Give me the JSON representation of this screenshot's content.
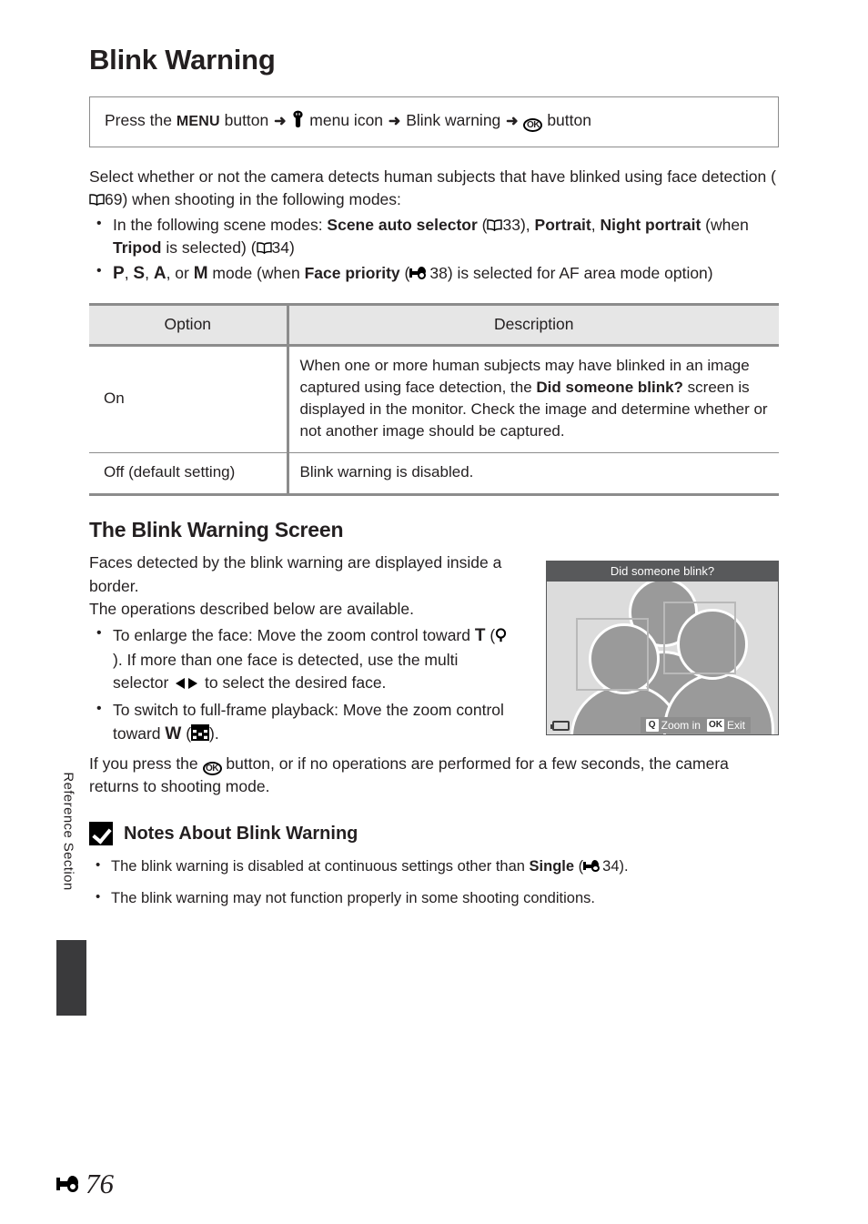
{
  "page": {
    "title": "Blink Warning",
    "side_label": "Reference Section",
    "page_number": "76"
  },
  "nav_box": {
    "lead": "Press the",
    "menu_button": "MENU",
    "button_word_1": "button",
    "menu_icon_label": "menu icon",
    "item": "Blink warning",
    "button_word_2": "button",
    "arrow": "➜",
    "icons": {
      "setup_menu": "wrench-icon",
      "ok": "ok-button-icon"
    }
  },
  "intro": {
    "line1": "Select whether or not the camera detects human subjects that have blinked",
    "line2_a": "using face detection (",
    "line2_ref": "69",
    "line2_b": ") when shooting in the following modes:",
    "bullets": [
      {
        "prefix": "In the following scene modes: ",
        "bold1": "Scene auto selector",
        "ref1": "33",
        "mid1": ", ",
        "bold2": "Portrait",
        "mid2": ", ",
        "bold3": "Night portrait",
        "mid3": " (when ",
        "bold4": "Tripod",
        "mid4": " is selected) (",
        "ref2": "34",
        "suffix": ")"
      },
      {
        "modes": [
          "P",
          "S",
          "A",
          "M"
        ],
        "mid1": ", or ",
        "mid2": " mode (when ",
        "bold1": "Face priority",
        "mid3": " (",
        "ref_e": "38",
        "suffix": ") is selected for AF area mode option)"
      }
    ]
  },
  "table": {
    "headers": [
      "Option",
      "Description"
    ],
    "rows": [
      {
        "option": "On",
        "description_a": "When one or more human subjects may have blinked in an image captured using face detection, the ",
        "description_b": "Did someone blink?",
        "description_c": " screen is displayed in the monitor. Check the image and determine whether or not another image should be captured."
      },
      {
        "option": "Off (default setting)",
        "description_a": "Blink warning is disabled.",
        "description_b": "",
        "description_c": ""
      }
    ]
  },
  "screen_section": {
    "title": "The Blink Warning Screen",
    "para1": "Faces detected by the blink warning are displayed inside a border.",
    "para2": "The operations described below are available.",
    "bullets": [
      {
        "a": "To enlarge the face: Move the zoom control toward ",
        "key": "T",
        "b": " (",
        "c": "). If more than one face is detected, use the multi selector ",
        "d": " to select the desired face."
      },
      {
        "a": "To switch to full-frame playback: Move the zoom control toward ",
        "key": "W",
        "b": " (",
        "c": ")."
      }
    ],
    "closing_a": "If you press the ",
    "closing_b": " button, or if no operations are performed for a few seconds, the camera returns to shooting mode."
  },
  "camera_screen": {
    "title": "Did someone blink?",
    "hints": [
      {
        "key": "Q",
        "label": "Zoom in",
        "icon": "magnifier-icon"
      },
      {
        "key": "OK",
        "label": "Exit",
        "icon": "ok-button-icon"
      }
    ],
    "battery_icon": "battery-icon"
  },
  "notes": {
    "title": "Notes About Blink Warning",
    "icon": "check-badge-icon",
    "items": [
      {
        "a": "The blink warning is disabled at continuous settings other than ",
        "bold": "Single",
        "b": " (",
        "ref_e": "34",
        "c": ")."
      },
      {
        "a": "The blink warning may not function properly in some shooting conditions.",
        "bold": "",
        "b": "",
        "ref_e": "",
        "c": ""
      }
    ]
  },
  "colors": {
    "text": "#231f20",
    "rule": "#8c8c8c",
    "table_header_bg": "#e6e6e6",
    "screen_title_bar": "#58595b",
    "screen_bg": "#dcdcdc",
    "figure_fill": "#9a9a9a",
    "tab": "#3a3a3c"
  }
}
